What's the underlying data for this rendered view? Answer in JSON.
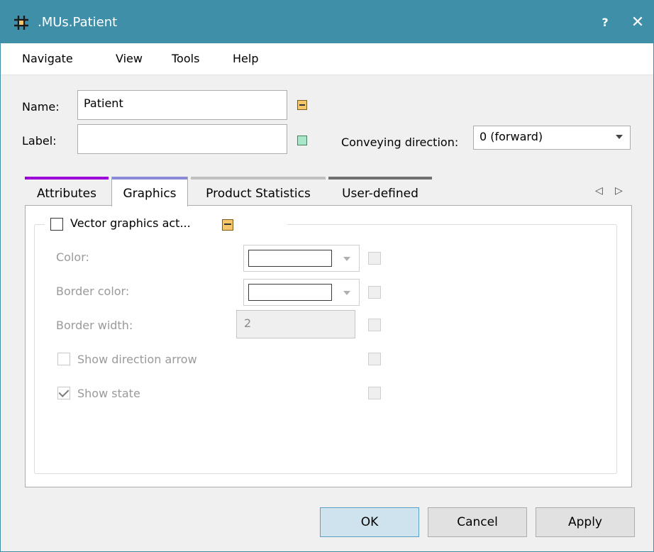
{
  "window": {
    "title": ".MUs.Patient",
    "help_label": "?",
    "close_label": "✕"
  },
  "menu": [
    {
      "label": "Navigate"
    },
    {
      "label": "View"
    },
    {
      "label": "Tools"
    },
    {
      "label": "Help"
    }
  ],
  "form": {
    "name_label": "Name:",
    "name_value": "Patient",
    "label_label": "Label:",
    "label_value": "",
    "conveying_label": "Conveying direction:",
    "conveying_value": "0 (forward)"
  },
  "tabs": [
    {
      "label": "Attributes",
      "color": "#9b00d9"
    },
    {
      "label": "Graphics",
      "color": "#8a8ad8",
      "active": true
    },
    {
      "label": "Product Statistics",
      "color": "#c0c0c0"
    },
    {
      "label": "User-defined",
      "color": "#707070"
    }
  ],
  "tab_nav": {
    "prev": "◁",
    "next": "▷"
  },
  "graphics": {
    "vector_label": "Vector graphics act...",
    "vector_checked": false,
    "color_label": "Color:",
    "border_color_label": "Border color:",
    "border_width_label": "Border width:",
    "border_width_value": "2",
    "show_arrow_label": "Show direction arrow",
    "show_arrow_checked": false,
    "show_state_label": "Show state",
    "show_state_checked": true
  },
  "buttons": {
    "ok": "OK",
    "cancel": "Cancel",
    "apply": "Apply"
  },
  "colors": {
    "titlebar": "#3f8fa8",
    "inherit_marker": "#f5c76a",
    "local_marker": "#a8e8c8"
  }
}
